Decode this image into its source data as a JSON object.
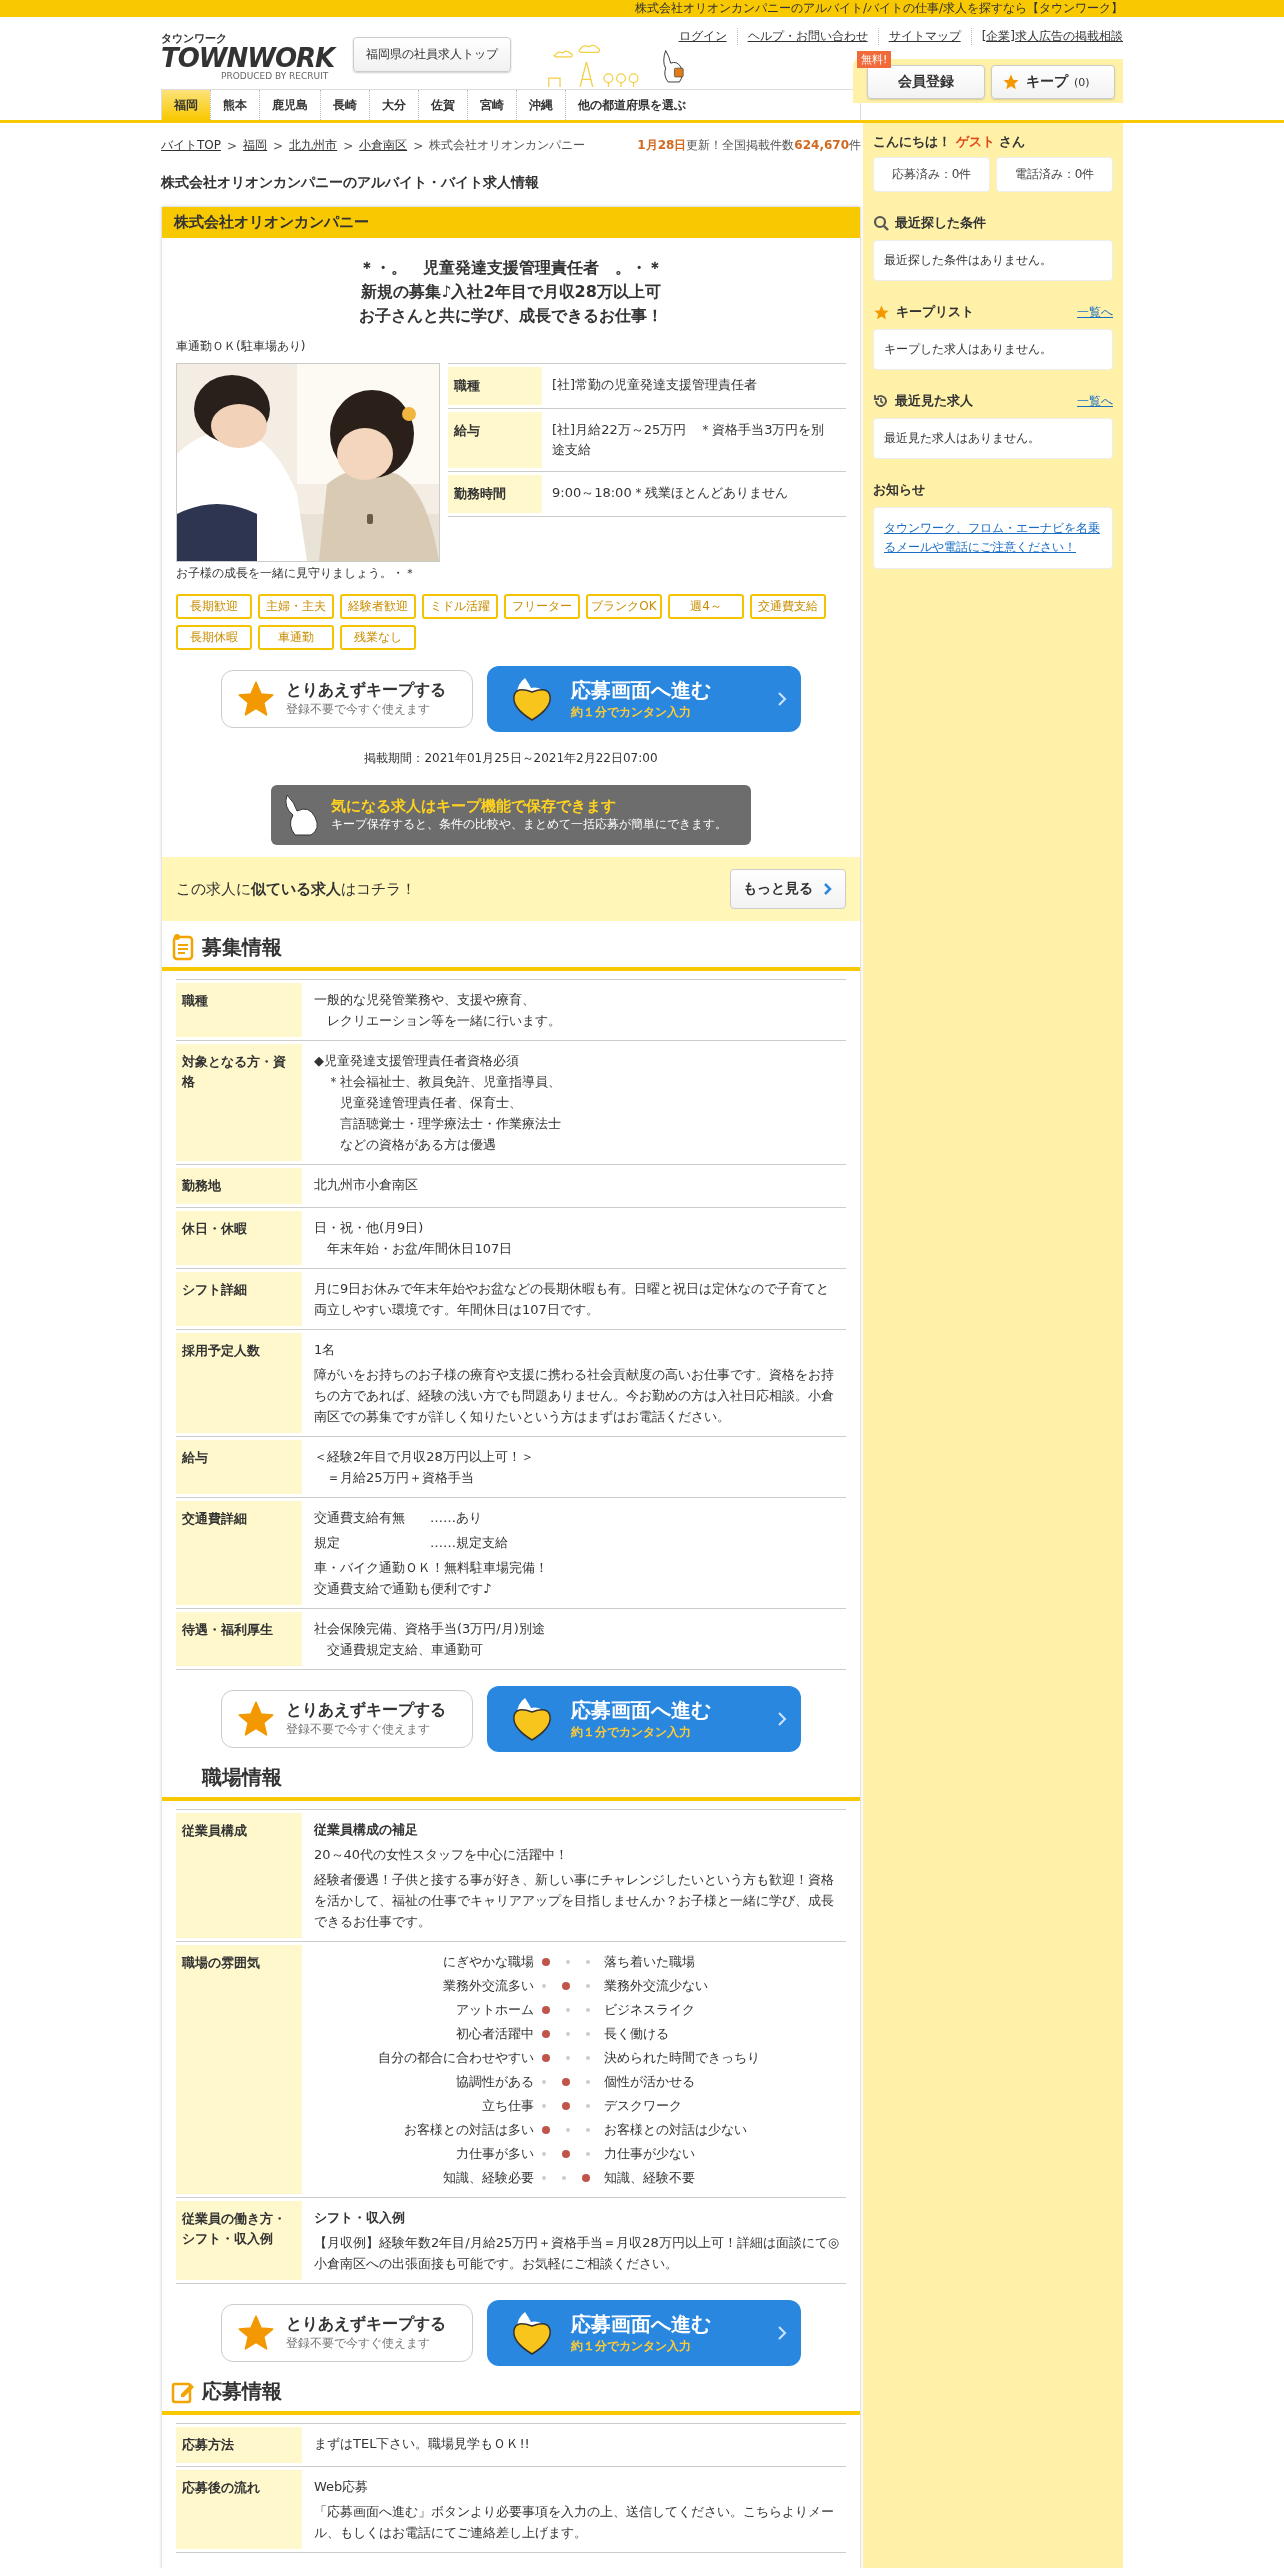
{
  "top_bar": {
    "text": "株式会社オリオンカンパニーのアルバイト/バイトの仕事/求人を探すなら【タウンワーク】"
  },
  "header": {
    "logo": {
      "kana": "タウンワーク",
      "name": "TOWNWORK",
      "byline": "PRODUCED BY RECRUIT"
    },
    "top_link": "福岡県の社員求人トップ",
    "links": [
      "ログイン",
      "ヘルプ・お問い合わせ",
      "サイトマップ",
      "[企業]求人広告の掲載相談"
    ],
    "register": {
      "badge": "無料!",
      "label": "会員登録"
    },
    "keep": {
      "label": "キープ",
      "count": "(0)"
    }
  },
  "nav": [
    {
      "label": "福岡",
      "selected": true
    },
    {
      "label": "熊本",
      "selected": false
    },
    {
      "label": "鹿児島",
      "selected": false
    },
    {
      "label": "長崎",
      "selected": false
    },
    {
      "label": "大分",
      "selected": false
    },
    {
      "label": "佐賀",
      "selected": false
    },
    {
      "label": "宮崎",
      "selected": false
    },
    {
      "label": "沖縄",
      "selected": false
    },
    {
      "label": "他の都道府県を選ぶ",
      "selected": false
    }
  ],
  "breadcrumb": {
    "separator": ">",
    "items": [
      {
        "label": "バイトTOP",
        "kind": "link"
      },
      {
        "label": "福岡",
        "kind": "link"
      },
      {
        "label": "北九州市",
        "kind": "link"
      },
      {
        "label": "小倉南区",
        "kind": "link"
      },
      {
        "label": "株式会社オリオンカンパニー",
        "kind": "current"
      }
    ],
    "update": {
      "date": "1月28日",
      "text": "更新！全国掲載件数",
      "count": "624,670",
      "unit": "件"
    }
  },
  "page_title": "株式会社オリオンカンパニーのアルバイト・バイト求人情報",
  "job": {
    "company": "株式会社オリオンカンパニー",
    "catch": [
      "＊・。　児童発達支援管理責任者　。・＊",
      "新規の募集♪入社2年目で月収28万以上可",
      "お子さんと共に学び、成長できるお仕事！"
    ],
    "note": "車通勤ＯＫ(駐車場あり)",
    "caption": "お子様の成長を一緒に見守りましょう。・＊",
    "summary": [
      {
        "label": "職種",
        "value": "[社]常勤の児童発達支援管理責任者"
      },
      {
        "label": "給与",
        "value": "[社]月給22万～25万円　＊資格手当3万円を別途支給"
      },
      {
        "label": "勤務時間",
        "value": "9:00～18:00＊残業ほとんどありません"
      }
    ],
    "tags": [
      "長期歓迎",
      "主婦・主夫",
      "経験者歓迎",
      "ミドル活躍",
      "フリーター",
      "ブランクOK",
      "週4～",
      "交通費支給",
      "長期休暇",
      "車通勤",
      "残業なし"
    ],
    "actions": {
      "keep_title": "とりあえずキープする",
      "keep_sub": "登録不要で今すぐ使えます",
      "apply_title": "応募画面へ進む",
      "apply_sub": "約１分でカンタン入力"
    },
    "period": "掲載期間：2021年01月25日～2021年2月22日07:00",
    "keep_banner": {
      "title": "気になる求人はキープ機能で保存できます",
      "text": "キープ保存すると、条件の比較や、まとめて一括応募が簡単にできます。"
    },
    "similar": {
      "text": "この求人に**似ている求人**はコチラ！",
      "button": "もっと見る"
    }
  },
  "sections": [
    {
      "title": "募集情報",
      "rows": [
        {
          "label": "職種",
          "blocks": [
            {
              "kind": "lines",
              "lines": [
                "一般的な児発管業務や、支援や療育、",
                "　レクリエーション等を一緒に行います。"
              ]
            }
          ]
        },
        {
          "label": "対象となる方・資格",
          "blocks": [
            {
              "kind": "lines",
              "lines": [
                "◆児童発達支援管理責任者資格必須",
                "　＊社会福祉士、教員免許、児童指導員、",
                "　　児童発達管理責任者、保育士、",
                "　　言語聴覚士・理学療法士・作業療法士",
                "　　などの資格がある方は優遇"
              ]
            }
          ]
        },
        {
          "label": "勤務地",
          "blocks": [
            {
              "kind": "lines",
              "lines": [
                "北九州市小倉南区"
              ]
            }
          ]
        },
        {
          "label": "休日・休暇",
          "blocks": [
            {
              "kind": "lines",
              "lines": [
                "日・祝・他(月9日)",
                "　年末年始・お盆/年間休日107日"
              ]
            }
          ]
        },
        {
          "label": "シフト詳細",
          "blocks": [
            {
              "kind": "para",
              "text": "月に9日お休みで年末年始やお盆などの長期休暇も有。日曜と祝日は定休なので子育てと両立しやすい環境です。年間休日は107日です。"
            }
          ]
        },
        {
          "label": "採用予定人数",
          "blocks": [
            {
              "kind": "lines",
              "lines": [
                "1名"
              ]
            },
            {
              "kind": "para",
              "text": "障がいをお持ちのお子様の療育や支援に携わる社会貢献度の高いお仕事です。資格をお持ちの方であれば、経験の浅い方でも問題ありません。今お勤めの方は入社日応相談。小倉南区での募集ですが詳しく知りたいという方はまずはお電話ください。"
            }
          ]
        },
        {
          "label": "給与",
          "blocks": [
            {
              "kind": "lines",
              "lines": [
                "＜経験2年目で月収28万円以上可！＞",
                "　＝月給25万円＋資格手当"
              ]
            }
          ]
        },
        {
          "label": "交通費詳細",
          "blocks": [
            {
              "kind": "pair",
              "label": "交通費支給有無",
              "value": "……あり"
            },
            {
              "kind": "pair",
              "label": "規定",
              "value": "……規定支給"
            },
            {
              "kind": "lines",
              "lines": [
                "車・バイク通勤ＯＫ！無料駐車場完備！",
                "交通費支給で通勤も便利です♪"
              ]
            }
          ]
        },
        {
          "label": "待遇・福利厚生",
          "blocks": [
            {
              "kind": "lines",
              "lines": [
                "社会保険完備、資格手当(3万円/月)別途",
                "　交通費規定支給、車通勤可"
              ]
            }
          ]
        }
      ],
      "actions": {
        "keep_title": "とりあえずキープする",
        "keep_sub": "登録不要で今すぐ使えます",
        "apply_title": "応募画面へ進む",
        "apply_sub": "約１分でカンタン入力"
      }
    },
    {
      "title": "職場情報",
      "rows": [
        {
          "label": "従業員構成",
          "blocks": [
            {
              "kind": "heading",
              "text": "従業員構成の補足"
            },
            {
              "kind": "lines",
              "lines": [
                "20～40代の女性スタッフを中心に活躍中！"
              ]
            },
            {
              "kind": "para",
              "text": "経験者優遇！子供と接する事が好き、新しい事にチャレンジしたいという方も歓迎！資格を活かして、福祉の仕事でキャリアアップを目指しませんか？お子様と一緒に学び、成長できるお仕事です。"
            }
          ]
        },
        {
          "label": "職場の雰囲気",
          "blocks": [
            {
              "kind": "scale",
              "items": [
                {
                  "left": "にぎやかな職場",
                  "right": "落ち着いた職場",
                  "dots": [
                    {
                      "selected": true
                    },
                    {
                      "selected": false
                    },
                    {
                      "selected": false
                    }
                  ]
                },
                {
                  "left": "業務外交流多い",
                  "right": "業務外交流少ない",
                  "dots": [
                    {
                      "selected": false
                    },
                    {
                      "selected": true
                    },
                    {
                      "selected": false
                    }
                  ]
                },
                {
                  "left": "アットホーム",
                  "right": "ビジネスライク",
                  "dots": [
                    {
                      "selected": true
                    },
                    {
                      "selected": false
                    },
                    {
                      "selected": false
                    }
                  ]
                },
                {
                  "left": "初心者活躍中",
                  "right": "長く働ける",
                  "dots": [
                    {
                      "selected": true
                    },
                    {
                      "selected": false
                    },
                    {
                      "selected": false
                    }
                  ]
                },
                {
                  "left": "自分の都合に合わせやすい",
                  "right": "決められた時間できっちり",
                  "dots": [
                    {
                      "selected": true
                    },
                    {
                      "selected": false
                    },
                    {
                      "selected": false
                    }
                  ]
                },
                {
                  "left": "協調性がある",
                  "right": "個性が活かせる",
                  "dots": [
                    {
                      "selected": false
                    },
                    {
                      "selected": true
                    },
                    {
                      "selected": false
                    }
                  ]
                },
                {
                  "left": "立ち仕事",
                  "right": "デスクワーク",
                  "dots": [
                    {
                      "selected": false
                    },
                    {
                      "selected": true
                    },
                    {
                      "selected": false
                    }
                  ]
                },
                {
                  "left": "お客様との対話は多い",
                  "right": "お客様との対話は少ない",
                  "dots": [
                    {
                      "selected": true
                    },
                    {
                      "selected": false
                    },
                    {
                      "selected": false
                    }
                  ]
                },
                {
                  "left": "力仕事が多い",
                  "right": "力仕事が少ない",
                  "dots": [
                    {
                      "selected": false
                    },
                    {
                      "selected": true
                    },
                    {
                      "selected": false
                    }
                  ]
                },
                {
                  "left": "知識、経験必要",
                  "right": "知識、経験不要",
                  "dots": [
                    {
                      "selected": false
                    },
                    {
                      "selected": false
                    },
                    {
                      "selected": true
                    }
                  ]
                }
              ]
            }
          ]
        },
        {
          "label": "従業員の働き方・シフト・収入例",
          "blocks": [
            {
              "kind": "heading",
              "text": "シフト・収入例"
            },
            {
              "kind": "para",
              "text": "【月収例】経験年数2年目/月給25万円＋資格手当＝月収28万円以上可！詳細は面談にて◎小倉南区への出張面接も可能です。お気軽にご相談ください。"
            }
          ]
        }
      ],
      "actions": {
        "keep_title": "とりあえずキープする",
        "keep_sub": "登録不要で今すぐ使えます",
        "apply_title": "応募画面へ進む",
        "apply_sub": "約１分でカンタン入力"
      }
    },
    {
      "title": "応募情報",
      "rows": [
        {
          "label": "応募方法",
          "blocks": [
            {
              "kind": "lines",
              "lines": [
                "まずはTEL下さい。職場見学もＯＫ!!"
              ]
            }
          ]
        },
        {
          "label": "応募後の流れ",
          "blocks": [
            {
              "kind": "lines",
              "lines": [
                "Web応募"
              ]
            },
            {
              "kind": "para",
              "text": "「応募画面へ進む」ボタンより必要事項を入力の上、送信してください。こちらよりメール、もしくはお電話にてご連絡差し上げます。"
            }
          ]
        }
      ]
    }
  ],
  "sidebar": {
    "greeting": {
      "pre": "こんにちは！",
      "name": "ゲスト",
      "post": "さん"
    },
    "counts": [
      "応募済み：0件",
      "電話済み：0件"
    ],
    "panels": [
      {
        "title": "最近探した条件",
        "body": "最近探した条件はありません。",
        "kind": "text"
      },
      {
        "title": "キープリスト",
        "link": "一覧へ",
        "body": "キープした求人はありません。",
        "kind": "text"
      },
      {
        "title": "最近見た求人",
        "link": "一覧へ",
        "body": "最近見た求人はありません。",
        "kind": "text"
      },
      {
        "title": "お知らせ",
        "body": "タウンワーク、フロム・エーナビを名乗るメールや電話にご注意ください！",
        "kind": "link"
      }
    ]
  }
}
